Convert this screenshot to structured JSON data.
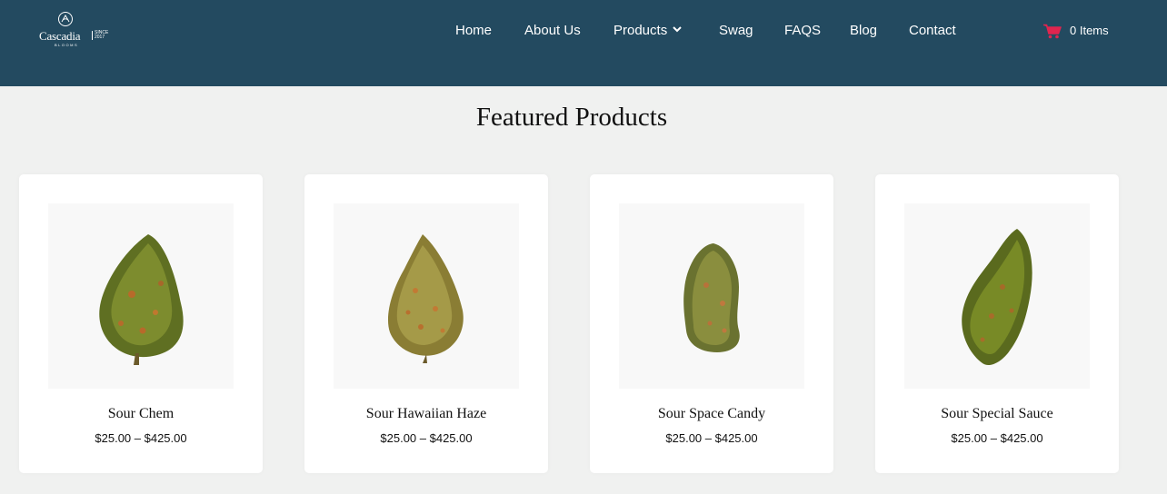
{
  "brand": {
    "name": "Cascadia",
    "since": "SINCE 2017",
    "sub": "BLOOMS"
  },
  "nav": {
    "items": [
      {
        "label": "Home"
      },
      {
        "label": "About Us"
      },
      {
        "label": "Products"
      },
      {
        "label": "Swag"
      },
      {
        "label": "FAQS"
      },
      {
        "label": "Blog"
      },
      {
        "label": "Contact"
      }
    ]
  },
  "cart": {
    "label": "0 Items",
    "icon": "cart-icon",
    "color": "#e0254f"
  },
  "section": {
    "title": "Featured Products"
  },
  "products": [
    {
      "name": "Sour Chem",
      "price": "$25.00 – $425.00"
    },
    {
      "name": "Sour Hawaiian Haze",
      "price": "$25.00 – $425.00"
    },
    {
      "name": "Sour Space Candy",
      "price": "$25.00 – $425.00"
    },
    {
      "name": "Sour Special Sauce",
      "price": "$25.00 – $425.00"
    }
  ],
  "colors": {
    "header": "#234a60",
    "page": "#f0f1f0",
    "card": "#ffffff"
  }
}
